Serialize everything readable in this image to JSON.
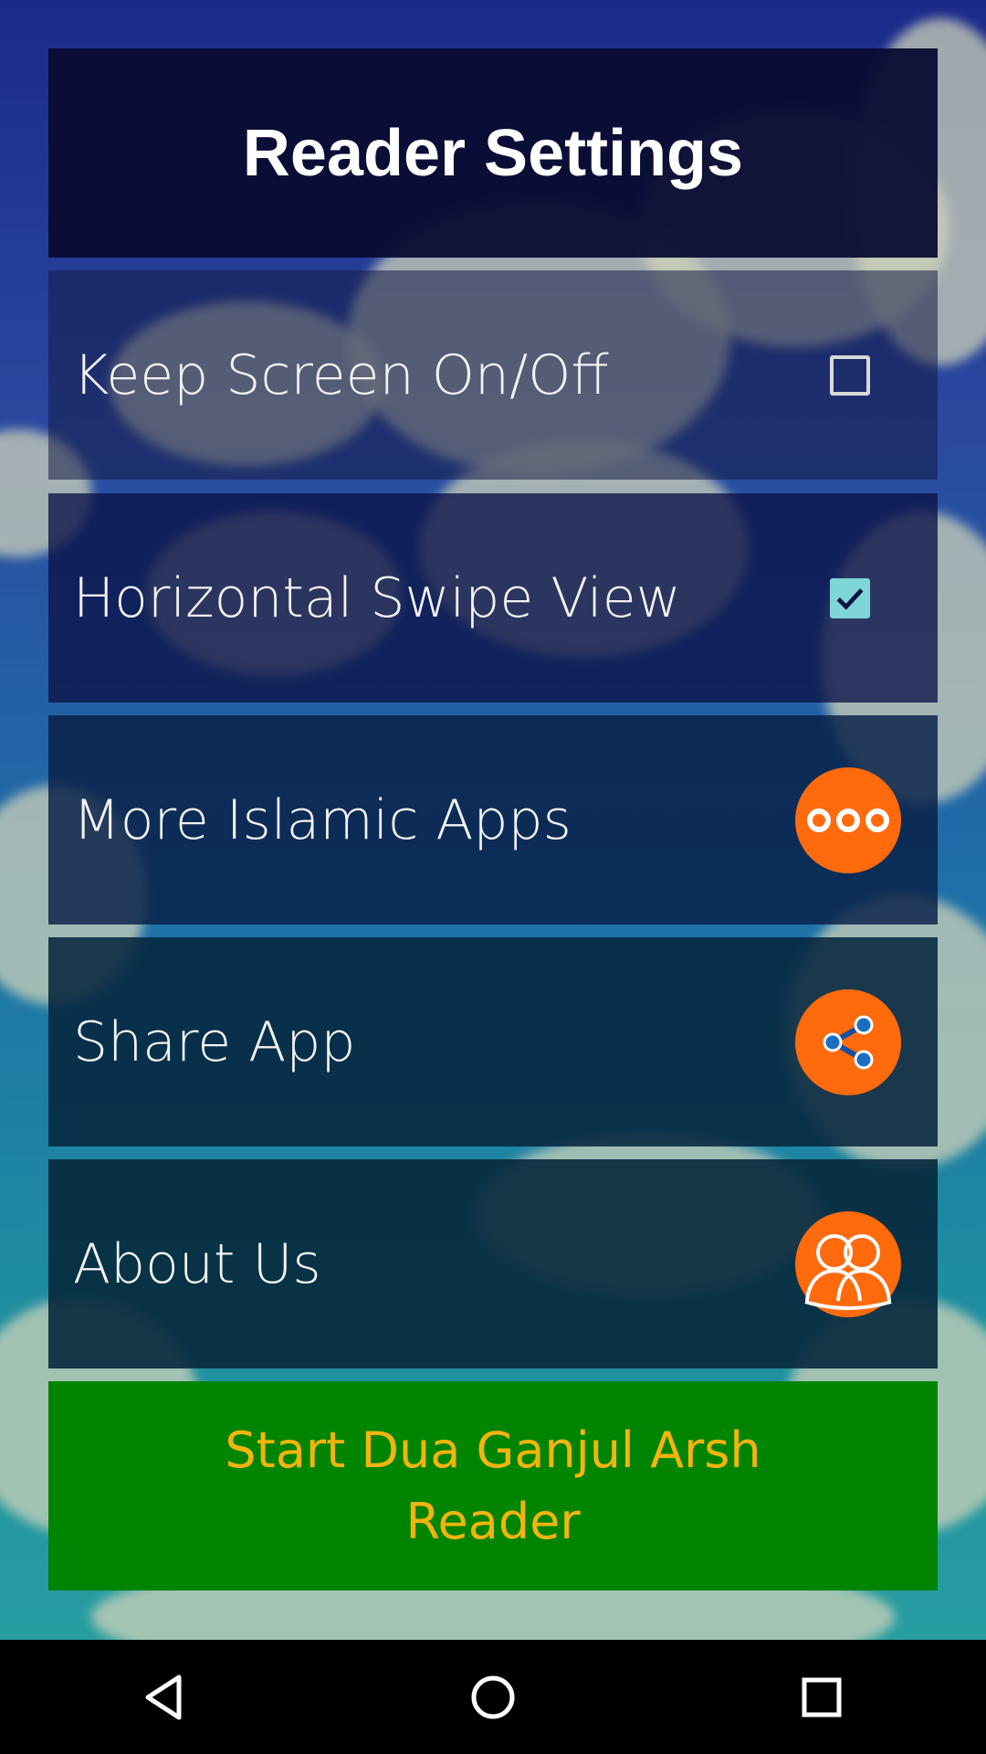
{
  "header": {
    "title": "Reader Settings"
  },
  "settings": {
    "items": [
      {
        "label": "Keep Screen On/Off",
        "control": "checkbox",
        "checked": false
      },
      {
        "label": "Horizontal Swipe View",
        "control": "checkbox",
        "checked": true
      },
      {
        "label": "More Islamic Apps",
        "control": "button",
        "icon": "more-dots-icon"
      },
      {
        "label": "Share App",
        "control": "button",
        "icon": "share-icon"
      },
      {
        "label": "About Us",
        "control": "button",
        "icon": "people-icon"
      }
    ]
  },
  "start_button": {
    "label": "Start Dua Ganjul Arsh Reader"
  },
  "navbar": {
    "icons": [
      "back-icon",
      "home-icon",
      "recents-icon"
    ]
  },
  "colors": {
    "accent": "#ff6a0d",
    "start_button_bg": "#018400",
    "start_button_text": "#f4b40c",
    "checkbox_checked": "#7fd6d6"
  }
}
